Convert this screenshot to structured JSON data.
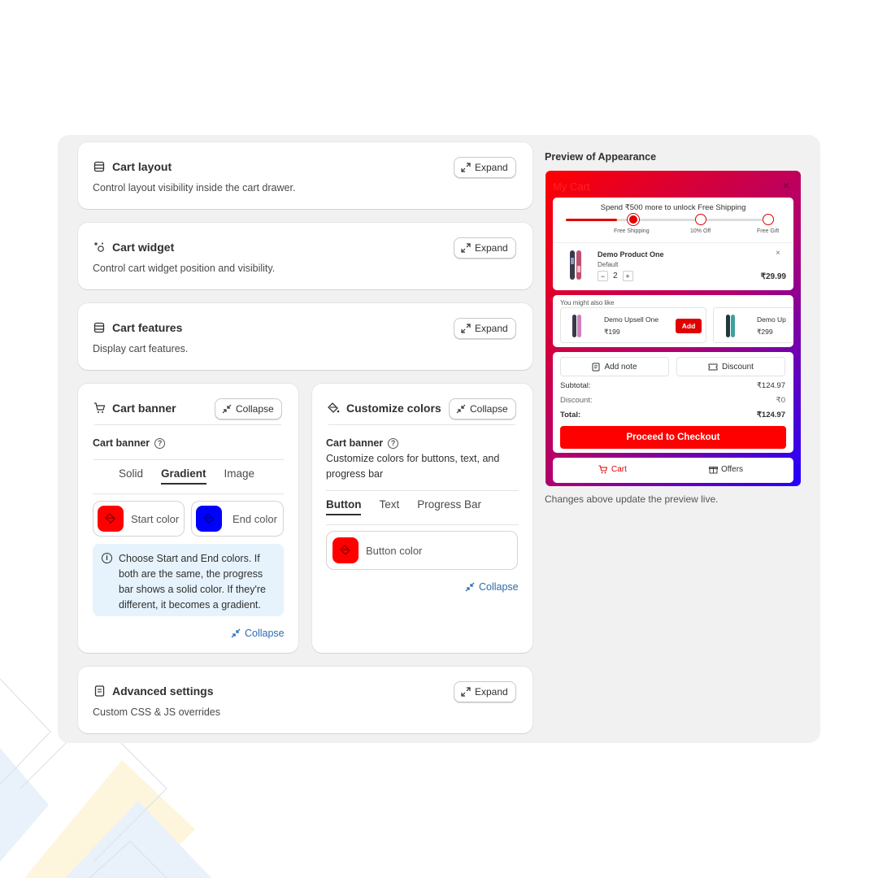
{
  "settings": {
    "cart_layout": {
      "title": "Cart layout",
      "desc": "Control layout visibility inside the cart drawer.",
      "action": "Expand"
    },
    "cart_widget": {
      "title": "Cart widget",
      "desc": "Control cart widget position and visibility.",
      "action": "Expand"
    },
    "cart_features": {
      "title": "Cart features",
      "desc": "Display cart features.",
      "action": "Expand"
    },
    "cart_banner": {
      "title": "Cart banner",
      "action": "Collapse",
      "sub_label": "Cart banner",
      "tabs": [
        "Solid",
        "Gradient",
        "Image"
      ],
      "active_tab": "Gradient",
      "start_color": {
        "label": "Start color",
        "value": "#ff0000"
      },
      "end_color": {
        "label": "End color",
        "value": "#0000ff"
      },
      "info": "Choose Start and End colors. If both are the same, the progress bar shows a solid color. If they're different, it becomes a gradient.",
      "collapse_link": "Collapse"
    },
    "customize_colors": {
      "title": "Customize colors",
      "action": "Collapse",
      "sub_label": "Cart banner",
      "desc": "Customize colors for buttons, text, and progress bar",
      "tabs": [
        "Button",
        "Text",
        "Progress Bar"
      ],
      "active_tab": "Button",
      "button_color": {
        "label": "Button color",
        "value": "#ff0000"
      },
      "collapse_link": "Collapse"
    },
    "advanced": {
      "title": "Advanced settings",
      "desc": "Custom CSS & JS overrides",
      "action": "Expand"
    }
  },
  "preview": {
    "title": "Preview of Appearance",
    "note": "Changes above update the preview live.",
    "cart": {
      "title": "My Cart",
      "close": "×",
      "shipping_msg": "Spend ₹500 more to unlock Free Shipping",
      "milestones": [
        "Free Shipping",
        "10% Off",
        "Free Gift"
      ],
      "progress": 0.25,
      "product": {
        "name": "Demo Product One",
        "variant": "Default",
        "qty": "2",
        "price": "₹29.99",
        "minus": "−",
        "plus": "+",
        "remove": "×"
      },
      "upsell_heading": "You might also like",
      "upsells": [
        {
          "name": "Demo Upsell One",
          "price": "₹199",
          "add": "Add"
        },
        {
          "name": "Demo Up",
          "price": "₹299"
        }
      ],
      "add_note": "Add note",
      "discount_btn": "Discount",
      "subtotal_label": "Subtotal:",
      "subtotal": "₹124.97",
      "discount_label": "Discount:",
      "discount": "₹0",
      "total_label": "Total:",
      "total": "₹124.97",
      "checkout": "Proceed to Checkout",
      "nav_cart": "Cart",
      "nav_offers": "Offers",
      "accent": "#ff0000"
    }
  }
}
